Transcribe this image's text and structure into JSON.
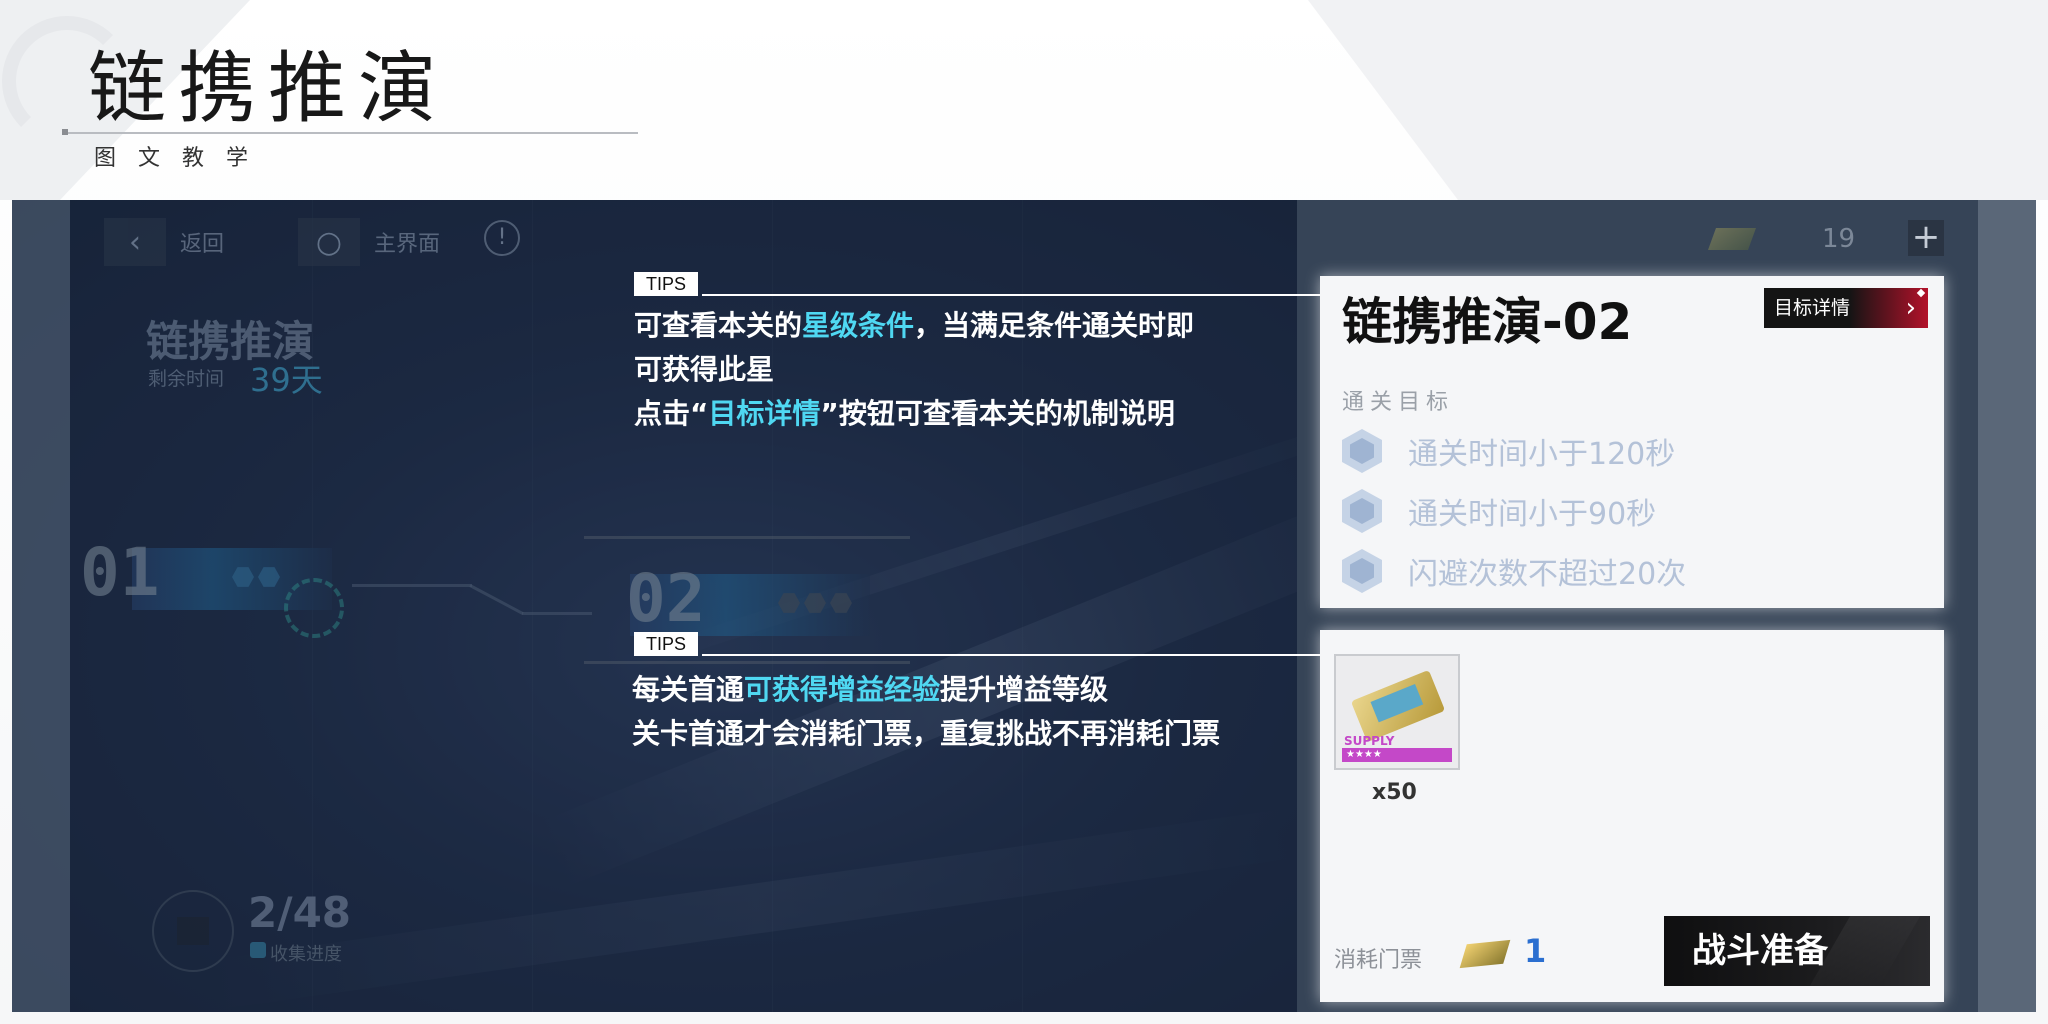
{
  "header": {
    "title": "链携推演",
    "subtitle": "图文教学"
  },
  "game": {
    "nav": {
      "back_label": "返回",
      "home_label": "主界面"
    },
    "event": {
      "title": "链携推演",
      "remaining_label": "剩余时间",
      "remaining_value": "39天"
    },
    "stages": [
      {
        "number": "01"
      },
      {
        "number": "02"
      }
    ],
    "collection": {
      "progress": "2/48",
      "label": "收集进度"
    },
    "currency": {
      "amount": "19",
      "add_symbol": "+"
    },
    "stage_detail": {
      "name": "链携推演-02",
      "detail_button": "目标详情",
      "objectives_heading": "通关目标",
      "objectives": [
        "通关时间小于120秒",
        "通关时间小于90秒",
        "闪避次数不超过20次"
      ]
    },
    "rewards": {
      "item_tag": "SUPPLY",
      "item_quantity": "x50",
      "cost_label": "消耗门票",
      "cost_value": "1",
      "battle_button": "战斗准备"
    }
  },
  "tips": [
    {
      "tag": "TIPS",
      "line1_a": "可查看本关的",
      "line1_hl": "星级条件",
      "line1_b": "，当满足条件通关时即",
      "line2": "可获得此星",
      "line3_a": "点击“",
      "line3_hl": "目标详情",
      "line3_b": "”按钮可查看本关的机制说明"
    },
    {
      "tag": "TIPS",
      "line1_a": "每关首通",
      "line1_hl": "可获得增益经验",
      "line1_b": "提升增益等级",
      "line2": "关卡首通才会消耗门票，重复挑战不再消耗门票"
    }
  ],
  "colors": {
    "highlight": "#4fd8f2",
    "detail_button_red": "#b3122a",
    "cost_blue": "#2b6fd0",
    "objective_inactive": "#b4c2d8"
  }
}
